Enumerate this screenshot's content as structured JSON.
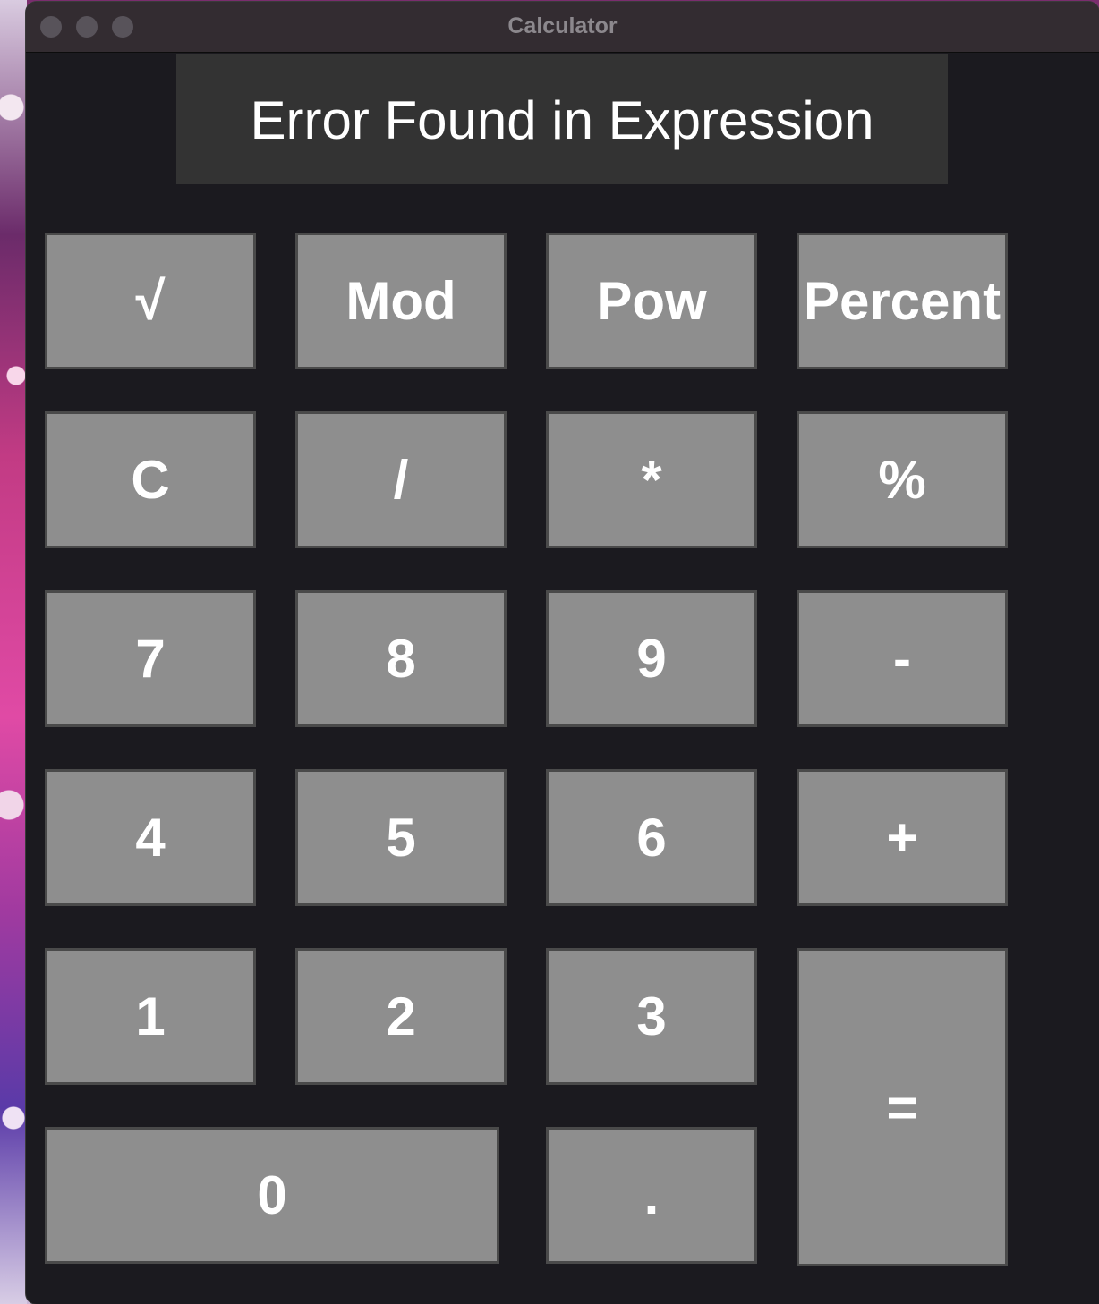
{
  "window": {
    "title": "Calculator"
  },
  "display": {
    "text": "Error Found in Expression"
  },
  "keys": {
    "sqrt": "√",
    "mod": "Mod",
    "pow": "Pow",
    "percent_word": "Percent",
    "clear": "C",
    "divide": "/",
    "multiply": "*",
    "percent_symbol": "%",
    "seven": "7",
    "eight": "8",
    "nine": "9",
    "minus": "-",
    "four": "4",
    "five": "5",
    "six": "6",
    "plus": "+",
    "one": "1",
    "two": "2",
    "three": "3",
    "equals": "=",
    "zero": "0",
    "decimal": "."
  },
  "colors": {
    "window_bg": "#1b1a1f",
    "titlebar_bg": "#332c31",
    "display_bg": "#333333",
    "key_bg": "#8e8e8e",
    "key_border": "#4a4a4a",
    "text": "#ffffff"
  }
}
